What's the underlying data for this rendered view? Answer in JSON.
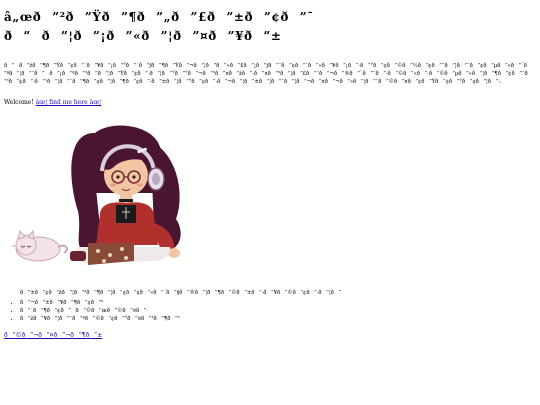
{
  "header": {
    "line1": "â„œð ”²ð ”Ÿð ”¶ð ”„ð ”£ð ”±ð ”¢ð ”¯",
    "line2": "ð ” ð ”¦ð ”¡ð ”«ð ”¦ð ”¤ð ”¥ð ”±"
  },
  "intro": {
    "text": "ð ” ð ”žð ”¶ð ”Ÿð ”¢ð ”´ð ”¥ð ”¡ð ”°ð ”´ð ”ƒð ”¶ð ”Ÿð ”¬ð ”¦ð ”­ð ”«ð ”£ð ”¡ð ”ƒð ”¯ð ”¢ð ”¯ð ”«ð ”¥ð ”¡ð ”·ð ”°ð ”¢ð ”©ð ”½ð ”¢ð ”¯ð ”¦ð ”¯ð ”¢ð ”µð ”«ð ”¨ð ”ºð ”¦ð ”¯ð ” ð ”¡ð ”ºð ”³ð ”ð ”¦ð ”Ÿð ”¢ð ”·ð ”¦ð ”°ð ”°ð ”¬ð ”³ð ”¤ð ”žð ”·ð ”¤ð ”³ð ”¦ð ”£ð ”¯ð ”¬ð ”®ð ”¨ð ”¯ð ”·ð ”©ð ”«ð ”·ð ”©ð ”µð ”«ð ”¦ð ”¶ð ”¢ð ”¯ð ”³ð ”¢ð ”·ð ”¹ð ”¦ð ”¯ð ”¶ð ”¢ð ”¦ð ”¶ð ”¢ð ”·ð ”±ð ”¦ð ”°ð ”¢ð ”·ð ”¬ð ”¦ð ”±ð ”¦ð ”¯ð ”¦ð ”¬ð ”¤ð ”¬ð ”»ð ”¦ð ”¯ð ”©ð ”¤ð ”¢ð ”Ÿð ”¢ð ”°ð ”¢ð ”¦ð ”·."
  },
  "welcome": {
    "prefix": "Welcome! ",
    "link_text": "âœ¦ find me here âœ¦"
  },
  "avatar": {
    "description_icon": "avatar-illustration-icon",
    "hair_color": "#4a1530",
    "shirt_color": "#b0302e",
    "skin_color": "#f2c5a3",
    "cat_color": "#f3e3e7",
    "headphone_color": "#e8e0e8"
  },
  "list": {
    "intro": "ð ”±ð ”¢ð ”žð ”¦ð ”³ð ”¶ð ”¦ð ”¢ð ”¢ð ”«ð ”´ð ”§ð ”®ð ”¦ð ”¶ð ”©ð ”±ð ”·ð ”¥ð ”©ð ”¢ð ”·ð ”¦ð ”",
    "items": [
      "ð ”¬ð ”±ð ”¥ð ”¶ð ”¢ð ”²",
      "ð ”´ð ”¶ð ”¢ð ” ð ”©ð ”œð ”©ð ”¤ð ”·",
      "ð ”žð ”¥ð ”¦ð ”¯ð ”ºð ”©ð ”¢ð ”°ð ”¤ð ”³ð ”¶ð ”²"
    ]
  },
  "bottom_link": {
    "text": "ð ”©ð ”¬ð ”¤ð ”¬ð ”¶ð ”±"
  },
  "colors": {
    "link": "#1a0dab",
    "text": "#000000",
    "background": "#ffffff"
  }
}
